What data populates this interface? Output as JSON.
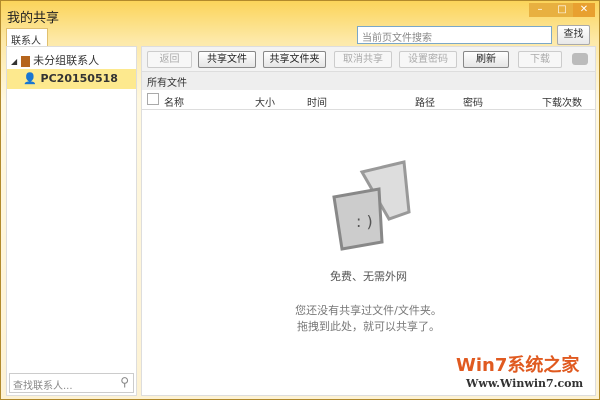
{
  "window": {
    "title": "我的共享"
  },
  "tabs": {
    "contacts": "联系人"
  },
  "search": {
    "placeholder": "当前页文件搜索",
    "button": "查找"
  },
  "sidebar": {
    "group": "未分组联系人",
    "selected_contact": "PC20150518",
    "find_placeholder": "查找联系人..."
  },
  "toolbar": {
    "back": "返回",
    "share_file": "共享文件",
    "share_folder": "共享文件夹",
    "cancel_share": "取消共享",
    "set_password": "设置密码",
    "refresh": "刷新",
    "download": "下载"
  },
  "breadcrumb": "所有文件",
  "columns": {
    "name": "名称",
    "size": "大小",
    "time": "时间",
    "path": "路径",
    "password": "密码",
    "downloads": "下载次数"
  },
  "empty": {
    "headline": "免费、无需外网",
    "line1": "您还没有共享过文件/文件夹。",
    "line2": "拖拽到此处，就可以共享了。"
  },
  "watermark": {
    "brand": "Win7系统之家",
    "url": "Www.Winwin7.com"
  }
}
